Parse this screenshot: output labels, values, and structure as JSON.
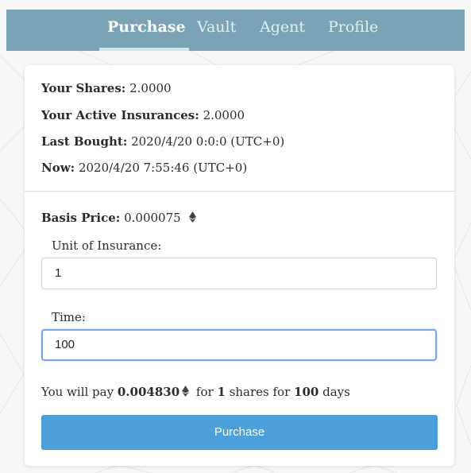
{
  "nav": {
    "tabs": [
      {
        "label": "Purchase",
        "active": true
      },
      {
        "label": "Vault",
        "active": false
      },
      {
        "label": "Agent",
        "active": false
      },
      {
        "label": "Profile",
        "active": false
      }
    ]
  },
  "account": {
    "shares_label": "Your Shares:",
    "shares_value": "2.0000",
    "insurances_label": "Your Active Insurances:",
    "insurances_value": "2.0000",
    "last_bought_label": "Last Bought:",
    "last_bought_value": "2020/4/20 0:0:0 (UTC+0)",
    "now_label": "Now:",
    "now_value": "2020/4/20 7:55:46 (UTC+0)"
  },
  "form": {
    "basis_price_label": "Basis Price:",
    "basis_price_value": "0.000075",
    "unit_label": "Unit of Insurance:",
    "unit_value": "1",
    "time_label": "Time:",
    "time_value": "100",
    "pay_prefix": "You will pay",
    "pay_amount": "0.004830",
    "pay_for": "for",
    "pay_shares": "1",
    "pay_shares_suffix": "shares for",
    "pay_days": "100",
    "pay_days_suffix": "days",
    "submit_label": "Purchase"
  },
  "colors": {
    "topbar": "#7aa4b6",
    "button": "#4c9fd9",
    "focus_border": "#7aa3e8"
  },
  "icons": {
    "currency": "ethereum-icon"
  }
}
